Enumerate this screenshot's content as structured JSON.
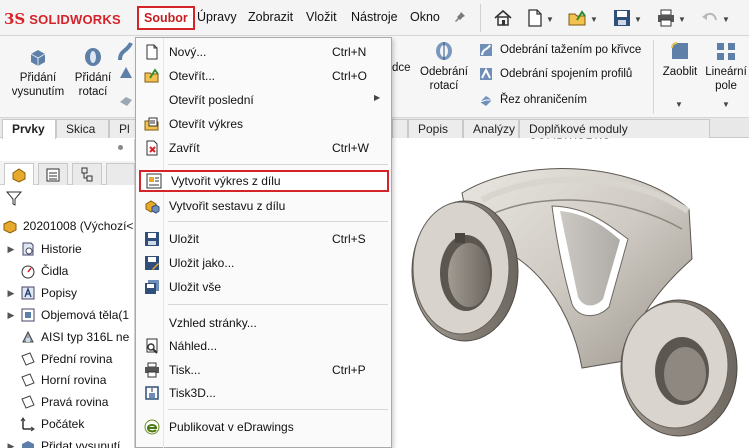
{
  "app": {
    "brand": "SOLIDWORKS",
    "brand_mark": "3S"
  },
  "menubar": {
    "items": [
      "Soubor",
      "Úpravy",
      "Zobrazit",
      "Vložit",
      "Nástroje",
      "Okno"
    ]
  },
  "ribbon": {
    "left_buttons": [
      {
        "label1": "Přidání",
        "label2": "vysunutím"
      },
      {
        "label1": "Přidání",
        "label2": "rotací"
      }
    ],
    "partial_label": "dce",
    "cut_rotate": {
      "label1": "Odebrání",
      "label2": "rotací"
    },
    "right_items": [
      "Odebrání tažením po křivce",
      "Odebrání spojením profilů",
      "Řez ohraničením"
    ],
    "fillet": "Zaoblit",
    "pattern": {
      "label1": "Lineární",
      "label2": "pole"
    }
  },
  "tabs": {
    "items": [
      "Prvky",
      "Skica",
      "Pl",
      "Popis",
      "Analýzy",
      "Doplňkové moduly SOLIDWORKS"
    ]
  },
  "tree": {
    "root": "20201008 (Výchozí<",
    "items": [
      "Historie",
      "Čidla",
      "Popisy",
      "Objemová těla(1",
      "AISI typ 316L ne",
      "Přední rovina",
      "Horní rovina",
      "Pravá rovina",
      "Počátek",
      "Přidat vysunutí"
    ]
  },
  "file_menu": {
    "items": [
      {
        "label": "Nový...",
        "shortcut": "Ctrl+N",
        "icon": "new-doc-icon"
      },
      {
        "label": "Otevřít...",
        "shortcut": "Ctrl+O",
        "icon": "open-folder-icon"
      },
      {
        "label": "Otevřít poslední",
        "shortcut": "",
        "icon": "",
        "submenu": "▶"
      },
      {
        "label": "Otevřít výkres",
        "shortcut": "",
        "icon": "open-drawing-icon"
      },
      {
        "label": "Zavřít",
        "shortcut": "Ctrl+W",
        "icon": "close-doc-icon"
      },
      {
        "label": "Vytvořit výkres z dílu",
        "shortcut": "",
        "icon": "make-drawing-icon"
      },
      {
        "label": "Vytvořit sestavu z dílu",
        "shortcut": "",
        "icon": "make-assembly-icon"
      },
      {
        "label": "Uložit",
        "shortcut": "Ctrl+S",
        "icon": "save-icon"
      },
      {
        "label": "Uložit jako...",
        "shortcut": "",
        "icon": "save-as-icon"
      },
      {
        "label": "Uložit vše",
        "shortcut": "",
        "icon": "save-all-icon"
      },
      {
        "label": "Vzhled stránky...",
        "shortcut": "",
        "icon": ""
      },
      {
        "label": "Náhled...",
        "shortcut": "",
        "icon": "preview-icon"
      },
      {
        "label": "Tisk...",
        "shortcut": "Ctrl+P",
        "icon": "print-icon"
      },
      {
        "label": "Tisk3D...",
        "shortcut": "",
        "icon": "print3d-icon"
      },
      {
        "label": "Publikovat v eDrawings",
        "shortcut": "",
        "icon": "edrawings-icon"
      }
    ]
  },
  "colors": {
    "accent": "#d6232a",
    "menu_bg": "#fafafa",
    "ribbon_bg": "#f6f6f6"
  }
}
